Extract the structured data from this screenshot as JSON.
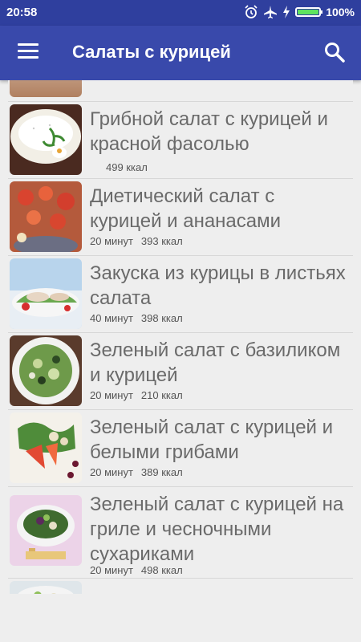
{
  "status": {
    "time": "20:58",
    "battery_pct": "100%",
    "battery_level": 1.0
  },
  "appbar": {
    "title": "Салаты с курицей",
    "menu_icon": "menu-icon",
    "search_icon": "search-icon"
  },
  "recipes": [
    {
      "name": "",
      "time": "",
      "kcal": ""
    },
    {
      "name": "Грибной салат с курицей и красной фасолью",
      "time": "",
      "kcal": "499 ккал"
    },
    {
      "name": "Диетический салат с курицей и ананасами",
      "time": "20 минут",
      "kcal": "393 ккал"
    },
    {
      "name": "Закуска из курицы в листьях салата",
      "time": "40 минут",
      "kcal": "398 ккал"
    },
    {
      "name": "Зеленый салат с базиликом и курицей",
      "time": "20 минут",
      "kcal": "210 ккал"
    },
    {
      "name": "Зеленый салат с курицей и белыми грибами",
      "time": "20 минут",
      "kcal": "389 ккал"
    },
    {
      "name": "Зеленый салат с курицей на гриле и чесночными сухариками",
      "time": "20 минут",
      "kcal": "498 ккал"
    },
    {
      "name": "",
      "time": "",
      "kcal": ""
    }
  ]
}
